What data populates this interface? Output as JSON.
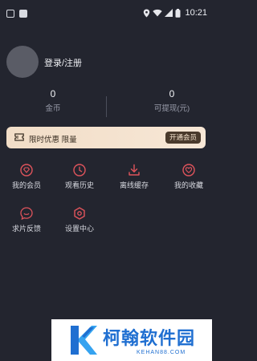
{
  "status_bar": {
    "time": "10:21",
    "icons": [
      "notification-square-icon",
      "image-square-icon",
      "location-icon",
      "wifi-icon",
      "signal-icon",
      "battery-icon"
    ]
  },
  "profile": {
    "login_label": "登录/注册"
  },
  "stats": [
    {
      "value": "0",
      "label": "金币"
    },
    {
      "value": "0",
      "label": "可提现(元)"
    }
  ],
  "vip_banner": {
    "promo_text": "限时优惠 限量",
    "button_label": "开通会员",
    "colors": {
      "bg": "#f1ddc7",
      "button": "#4a3a2c"
    }
  },
  "menu": [
    {
      "label": "我的会员",
      "icon": "diamond-icon"
    },
    {
      "label": "观看历史",
      "icon": "clock-icon"
    },
    {
      "label": "离线缓存",
      "icon": "download-icon"
    },
    {
      "label": "我的收藏",
      "icon": "heart-icon"
    },
    {
      "label": "求片反馈",
      "icon": "feedback-icon"
    },
    {
      "label": "设置中心",
      "icon": "settings-icon"
    }
  ],
  "theme": {
    "background": "#23252f",
    "accent": "#e0545c"
  },
  "watermark": {
    "title": "柯翰软件园",
    "subtitle": "KEHAN88.COM"
  }
}
